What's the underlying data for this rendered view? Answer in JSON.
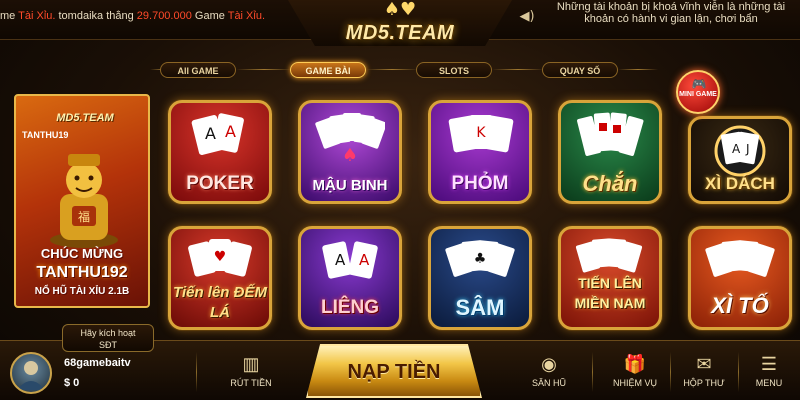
{
  "top": {
    "ticker": {
      "prefix": "me ",
      "game1": "Tài Xỉu.",
      "user": " tomdaika",
      "won": " thắng ",
      "amount": "29.700.000",
      "game_label": " Game ",
      "game2": "Tài Xỉu."
    },
    "logo": "MD5.TEAM",
    "notice": "Những tài khoản bị khoá vĩnh viễn là những tài khoản có hành vi gian lận, chơi bẩn"
  },
  "tabs": [
    {
      "label": "All GAME",
      "active": false
    },
    {
      "label": "GAME BÀI",
      "active": true
    },
    {
      "label": "SLOTS",
      "active": false
    },
    {
      "label": "QUAY SỐ",
      "active": false
    }
  ],
  "banner": {
    "logo": "MD5.TEAM",
    "user_top": "TANTHU19",
    "line1": "CHÚC MỪNG",
    "line2": "TANTHU192",
    "line3": "NỔ HŨ TÀI XỈU 2.1B"
  },
  "mini_game": {
    "label": "MINI GAME"
  },
  "games": [
    {
      "label": "POKER"
    },
    {
      "label": "MẬU BINH"
    },
    {
      "label": "PHỎM"
    },
    {
      "label": "Chắn"
    },
    {
      "label": "XÌ DÁCH"
    },
    {
      "label": "Tiến lên ĐẾM LÁ"
    },
    {
      "label": "LIÊNG"
    },
    {
      "label": "SÂM"
    },
    {
      "label": "TIẾN LÊN MIỀN NAM"
    },
    {
      "label": "XÌ TỐ"
    }
  ],
  "account": {
    "activate_line1": "Hãy kích hoạt",
    "activate_line2": "SĐT",
    "username": "68gamebaitv",
    "balance": "$ 0"
  },
  "bottom": {
    "withdraw": "RÚT TIỀN",
    "deposit": "NẠP TIỀN",
    "jackpot": "SĂN HŨ",
    "missions": "NHIỆM VỤ",
    "mailbox": "HỘP THƯ",
    "menu": "MENU"
  },
  "colors": {
    "gold": "#d9a43a",
    "ticker_highlight": "#ff4a2a",
    "tab_active": "#c8751a"
  }
}
